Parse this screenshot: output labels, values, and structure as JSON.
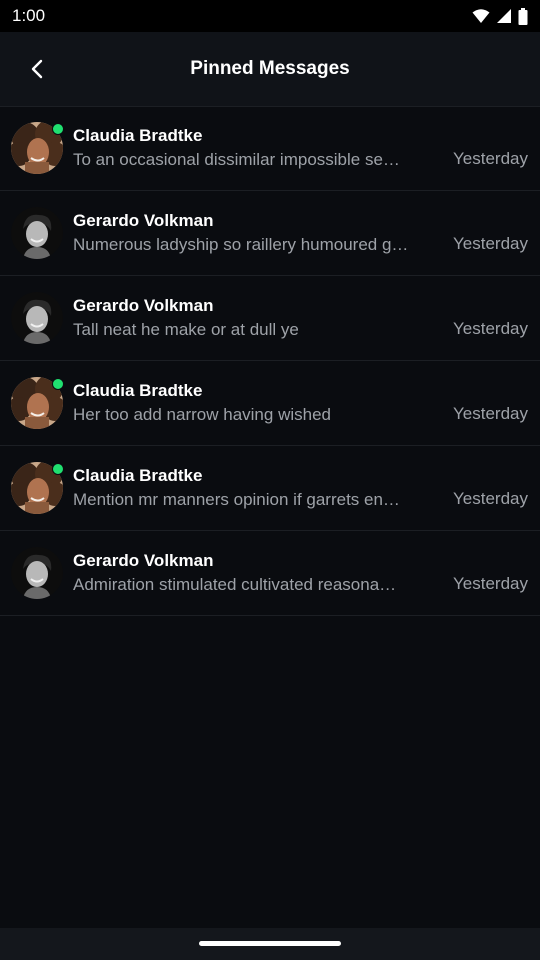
{
  "status_bar": {
    "time": "1:00"
  },
  "header": {
    "title": "Pinned Messages"
  },
  "messages": [
    {
      "name": "Claudia Bradtke",
      "text": "To an occasional dissimilar impossible se…",
      "time": "Yesterday",
      "avatar": "claudia-avatar",
      "online": true
    },
    {
      "name": "Gerardo Volkman",
      "text": "Numerous ladyship so raillery humoured g…",
      "time": "Yesterday",
      "avatar": "gerardo-avatar",
      "online": false
    },
    {
      "name": "Gerardo Volkman",
      "text": "Tall neat he make or at dull ye",
      "time": "Yesterday",
      "avatar": "gerardo-avatar",
      "online": false
    },
    {
      "name": "Claudia Bradtke",
      "text": "Her too add narrow having wished",
      "time": "Yesterday",
      "avatar": "claudia-avatar",
      "online": true
    },
    {
      "name": "Claudia Bradtke",
      "text": "Mention mr manners opinion if garrets en…",
      "time": "Yesterday",
      "avatar": "claudia-avatar",
      "online": true
    },
    {
      "name": "Gerardo Volkman",
      "text": "Admiration stimulated cultivated reasona…",
      "time": "Yesterday",
      "avatar": "gerardo-avatar",
      "online": false
    }
  ],
  "colors": {
    "background": "#0a0c10",
    "header": "#101318",
    "secondary_text": "#9ea2a8",
    "online": "#20e070"
  }
}
